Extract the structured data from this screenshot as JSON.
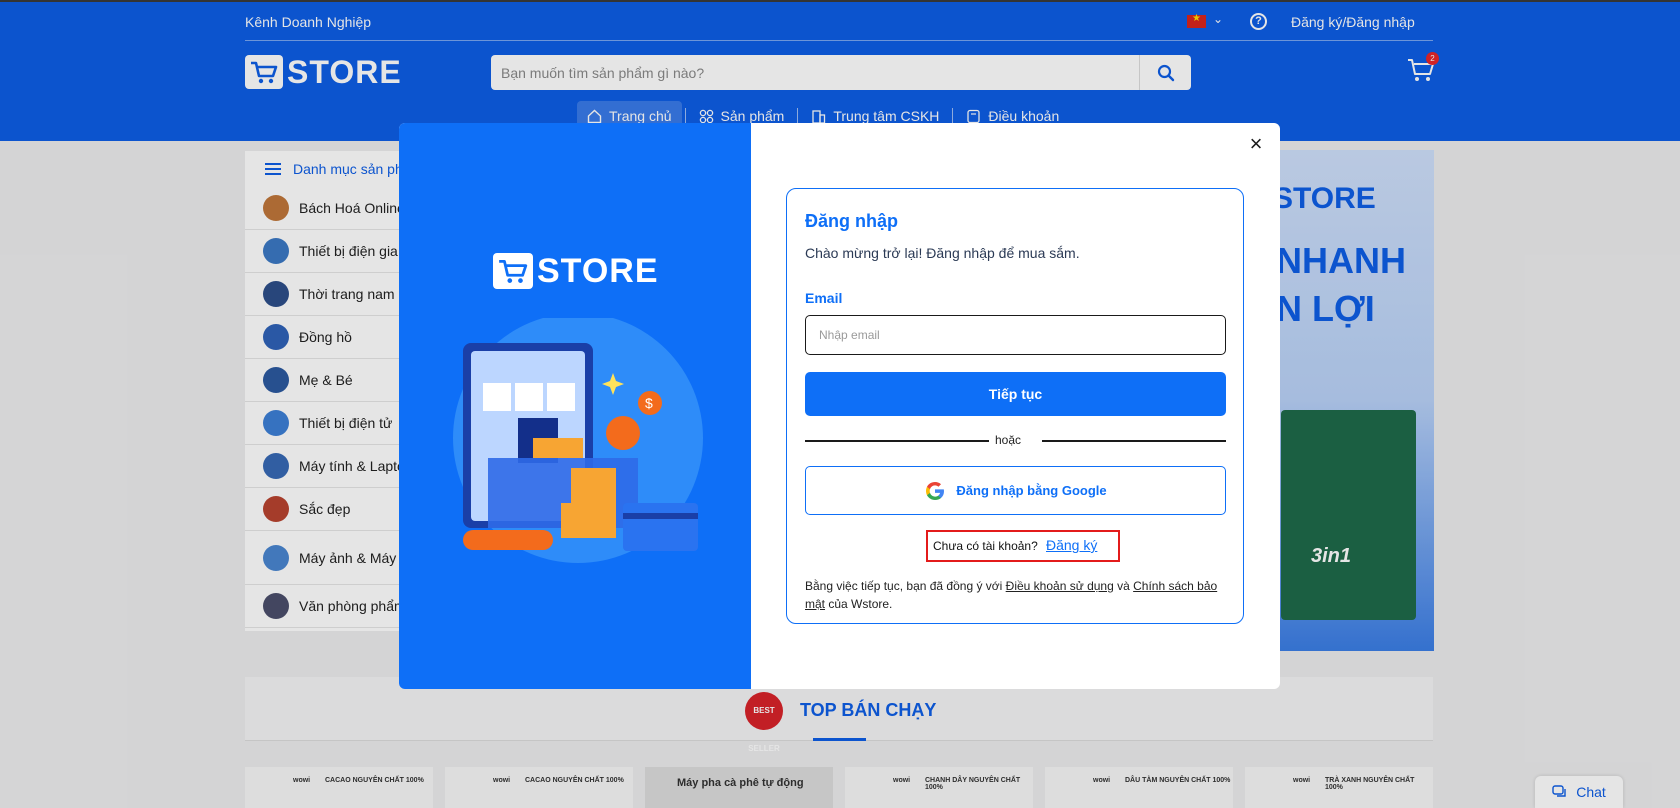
{
  "header": {
    "biz_link": "Kênh Doanh Nghiệp",
    "auth_link": "Đăng ký/Đăng nhập",
    "logo_text": "STORE",
    "search_placeholder": "Bạn muốn tìm sản phẩm gì nào?",
    "cart_count": "2",
    "nav": [
      "Trang chủ",
      "Sản phẩm",
      "Trung tâm CSKH",
      "Điều khoản"
    ]
  },
  "categories": {
    "title": "Danh mục sản phẩm",
    "items": [
      {
        "label": "Bách Hoá Online",
        "color": "#c0773a"
      },
      {
        "label": "Thiết bị điện gia dụng",
        "color": "#3b79c4"
      },
      {
        "label": "Thời trang nam & nữ",
        "color": "#2d4f8a"
      },
      {
        "label": "Đồng hồ",
        "color": "#2f63b8"
      },
      {
        "label": "Mẹ & Bé",
        "color": "#2c5aa0"
      },
      {
        "label": "Thiết bị điện tử",
        "color": "#3d7fd6"
      },
      {
        "label": "Máy tính & Laptop",
        "color": "#3769b5"
      },
      {
        "label": "Sắc đẹp",
        "color": "#b8432f"
      },
      {
        "label": "Máy ảnh & Máy quay phim",
        "color": "#4a86d1"
      },
      {
        "label": "Văn phòng phẩm",
        "color": "#4b4f6b"
      }
    ]
  },
  "banner": {
    "brand": "STORE",
    "line1": "NHANH",
    "line2": "N LỢI",
    "product": "3in1"
  },
  "top_selling": {
    "title": "TOP BÁN CHẠY",
    "badge": "BEST SELLER",
    "products": [
      {
        "brand": "wowi",
        "text": "CACAO NGUYÊN CHẤT 100%"
      },
      {
        "brand": "wowi",
        "text": "CACAO NGUYÊN CHẤT 100%"
      },
      {
        "brand": "",
        "text": "Máy pha cà phê tự động"
      },
      {
        "brand": "wowi",
        "text": "CHANH DÂY NGUYÊN CHẤT 100%"
      },
      {
        "brand": "wowi",
        "text": "DÂU TẰM NGUYÊN CHẤT 100%"
      },
      {
        "brand": "wowi",
        "text": "TRÀ XANH NGUYÊN CHẤT 100%"
      }
    ]
  },
  "chat": {
    "label": "Chat"
  },
  "modal": {
    "logo_text": "STORE",
    "title": "Đăng nhập",
    "subtitle": "Chào mừng trở lại! Đăng nhập để mua sắm.",
    "email_label": "Email",
    "email_placeholder": "Nhập email",
    "continue_label": "Tiếp tục",
    "or_label": "hoặc",
    "google_label": "Đăng nhập bằng Google",
    "signup_question": "Chưa có tài khoản?",
    "signup_link": "Đăng ký",
    "terms_prefix": "Bằng việc tiếp tục, bạn đã đồng ý với ",
    "terms_link": "Điều khoản sử dụng",
    "terms_and": " và ",
    "privacy_link": "Chính sách bảo mật",
    "terms_suffix": " của Wstore.",
    "close_icon": "×"
  },
  "colors": {
    "brand_blue": "#0e5ee6",
    "modal_blue": "#0e6ff7",
    "highlight_red": "#e31b1b"
  }
}
